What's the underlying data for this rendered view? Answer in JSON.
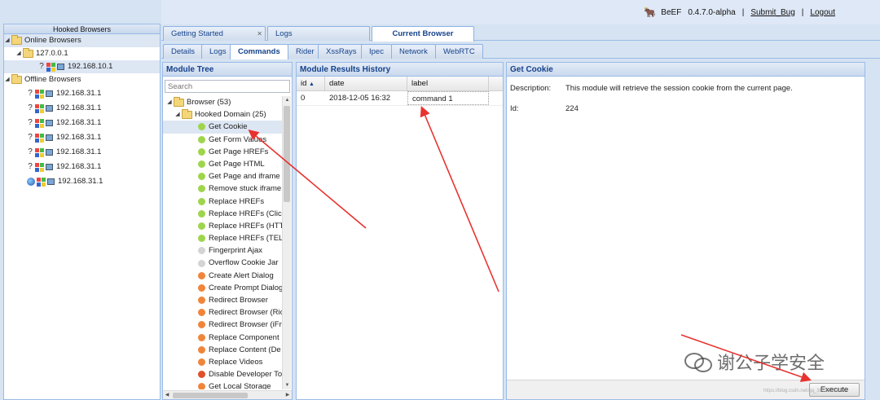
{
  "topbar": {
    "app_name": "BeEF",
    "version": "0.4.7.0-alpha",
    "separator": "|",
    "submit_bug": "Submit_Bug",
    "logout": "Logout"
  },
  "left_panel": {
    "title": "Hooked Browsers",
    "online_label": "Online Browsers",
    "online_host": "127.0.0.1",
    "online_browser_ip": "192.168.10.1",
    "offline_label": "Offline Browsers",
    "offline_ips": [
      "192.168.31.1",
      "192.168.31.1",
      "192.168.31.1",
      "192.168.31.1",
      "192.168.31.1",
      "192.168.31.1",
      "192.168.31.1"
    ],
    "offline_last_icon": "ie-icon"
  },
  "tabs_top": [
    {
      "label": "Getting Started",
      "closable": true
    },
    {
      "label": "Logs",
      "closable": false
    },
    {
      "label": "Current Browser",
      "active": true
    }
  ],
  "tabs_sub": [
    {
      "label": "Details"
    },
    {
      "label": "Logs"
    },
    {
      "label": "Commands",
      "active": true
    },
    {
      "label": "Rider"
    },
    {
      "label": "XssRays"
    },
    {
      "label": "Ipec"
    },
    {
      "label": "Network"
    },
    {
      "label": "WebRTC"
    }
  ],
  "module_tree": {
    "title": "Module Tree",
    "search_placeholder": "Search",
    "root": "Browser (53)",
    "group": "Hooked Domain (25)",
    "items": [
      {
        "label": "Get Cookie",
        "color": "green",
        "selected": true
      },
      {
        "label": "Get Form Values",
        "color": "green"
      },
      {
        "label": "Get Page HREFs",
        "color": "green"
      },
      {
        "label": "Get Page HTML",
        "color": "green"
      },
      {
        "label": "Get Page and iframe",
        "color": "green"
      },
      {
        "label": "Remove stuck iframe",
        "color": "green"
      },
      {
        "label": "Replace HREFs",
        "color": "green"
      },
      {
        "label": "Replace HREFs (Clic",
        "color": "green"
      },
      {
        "label": "Replace HREFs (HTT",
        "color": "green"
      },
      {
        "label": "Replace HREFs (TEL",
        "color": "green"
      },
      {
        "label": "Fingerprint Ajax",
        "color": "gray"
      },
      {
        "label": "Overflow Cookie Jar",
        "color": "gray"
      },
      {
        "label": "Create Alert Dialog",
        "color": "orange"
      },
      {
        "label": "Create Prompt Dialog",
        "color": "orange"
      },
      {
        "label": "Redirect Browser",
        "color": "orange"
      },
      {
        "label": "Redirect Browser (Ric",
        "color": "orange"
      },
      {
        "label": "Redirect Browser (iFr",
        "color": "orange"
      },
      {
        "label": "Replace Component",
        "color": "orange"
      },
      {
        "label": "Replace Content (De",
        "color": "orange"
      },
      {
        "label": "Replace Videos",
        "color": "orange"
      },
      {
        "label": "Disable Developer To",
        "color": "red"
      },
      {
        "label": "Get Local Storage",
        "color": "orange"
      }
    ]
  },
  "results": {
    "title": "Module Results History",
    "columns": {
      "id": "id",
      "date": "date",
      "label": "label"
    },
    "sort_indicator": "▲",
    "rows": [
      {
        "id": "0",
        "date": "2018-12-05 16:32",
        "label": "command 1"
      }
    ]
  },
  "detail": {
    "title": "Get Cookie",
    "description_key": "Description:",
    "description": "This module will retrieve the session cookie from the current page.",
    "id_key": "Id:",
    "id": "224",
    "execute_label": "Execute"
  },
  "watermark": {
    "text": "谢公子学安全",
    "url": "https://blog.csdn.net/qq_36119192"
  },
  "annotation_color": "#e8322f"
}
